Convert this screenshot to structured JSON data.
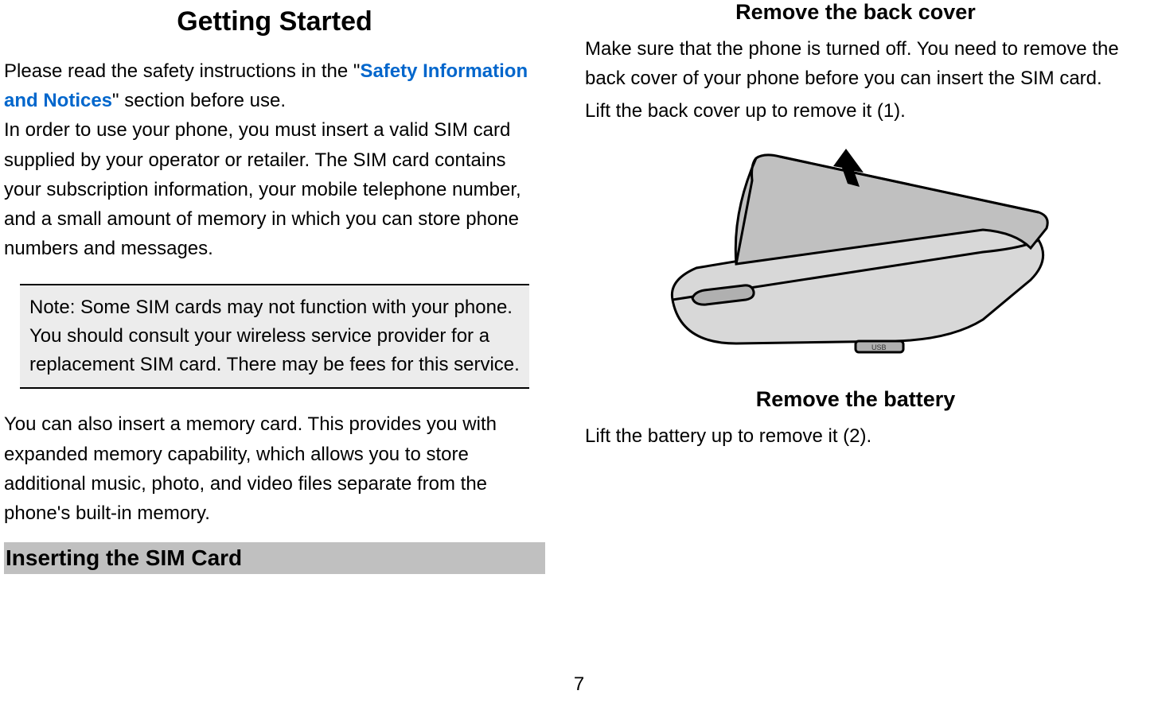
{
  "left": {
    "title": "Getting Started",
    "intro_prefix": "Please read the safety instructions in the \"",
    "intro_link": "Safety Information and Notices",
    "intro_suffix": "\" section before use.",
    "sim_para": "In order to use your phone, you must insert a valid SIM card supplied by your operator or retailer. The SIM card contains your subscription information, your mobile telephone number, and a small amount of memory in which you can store phone numbers and messages.",
    "note": "Note: Some SIM cards may not function with your phone. You should consult your wireless service provider for a replacement SIM card. There may be fees for this service.",
    "memory_para": "You can also insert a memory card. This provides you with expanded memory capability, which allows you to store additional music, photo, and video files separate from the phone's built-in memory.",
    "section_heading": "Inserting the SIM Card"
  },
  "right": {
    "heading_remove_cover": "Remove the back cover",
    "remove_cover_para1": "Make sure that the phone is turned off. You need to remove the back cover of your phone before you can insert the SIM card.",
    "remove_cover_para2": "Lift the back cover up to remove it (1).",
    "heading_remove_battery": "Remove the battery",
    "remove_battery_para": "Lift the battery up to remove it (2)."
  },
  "page_number": "7"
}
